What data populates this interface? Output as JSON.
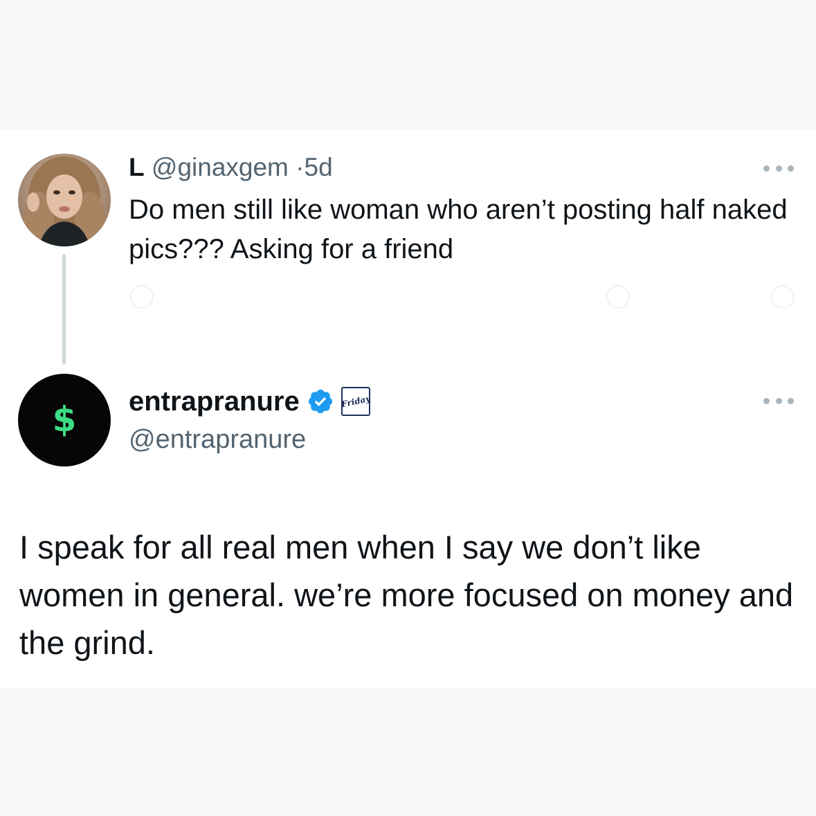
{
  "tweet_original": {
    "name": "L",
    "handle": "@ginaxgem",
    "separator": "·",
    "age": "5d",
    "text": "Do men still like woman who aren’t posting half naked pics??? Asking for a friend",
    "avatar_icon": "profile-photo"
  },
  "tweet_reply": {
    "name": "entrapranure",
    "handle": "@entrapranure",
    "verified": true,
    "affiliation_badge_text": "Friday",
    "avatar_symbol": "$",
    "text": "I speak for all real men when I say we don’t like women in general. we’re more focused on money and the grind."
  },
  "colors": {
    "verified_blue": "#1d9bf0",
    "dollar_green": "#3ddc84",
    "muted_text": "#536471",
    "thread_line": "#cfd9de"
  }
}
